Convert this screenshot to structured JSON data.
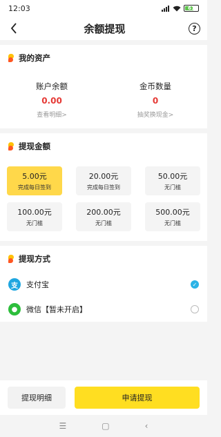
{
  "status_bar": {
    "time": "12:03",
    "battery": "61"
  },
  "header": {
    "title": "余额提现",
    "help_icon": "question-circle-icon",
    "back_icon": "chevron-left-icon"
  },
  "assets": {
    "title": "我的资产",
    "balance": {
      "label": "账户余额",
      "value": "0.00",
      "link": "查看明细>"
    },
    "coins": {
      "label": "金币数量",
      "value": "0",
      "link": "抽奖换现金>"
    }
  },
  "amounts": {
    "title": "提现金额",
    "options": [
      {
        "value": "5.00元",
        "sub": "完成每日签到",
        "selected": true
      },
      {
        "value": "20.00元",
        "sub": "完成每日签到",
        "selected": false
      },
      {
        "value": "50.00元",
        "sub": "无门槛",
        "selected": false
      },
      {
        "value": "100.00元",
        "sub": "无门槛",
        "selected": false
      },
      {
        "value": "200.00元",
        "sub": "无门槛",
        "selected": false
      },
      {
        "value": "500.00元",
        "sub": "无门槛",
        "selected": false
      }
    ]
  },
  "payment": {
    "title": "提现方式",
    "methods": [
      {
        "label": "支付宝",
        "icon": "alipay-icon",
        "checked": true
      },
      {
        "label": "微信【暂未开启】",
        "icon": "wechat-icon",
        "checked": false
      }
    ]
  },
  "bottom": {
    "detail_label": "提现明细",
    "apply_label": "申请提现"
  },
  "colors": {
    "accent": "#ffde21",
    "amount_red": "#e53935",
    "alipay": "#1fa6e0",
    "wechat": "#2dbe3c"
  }
}
